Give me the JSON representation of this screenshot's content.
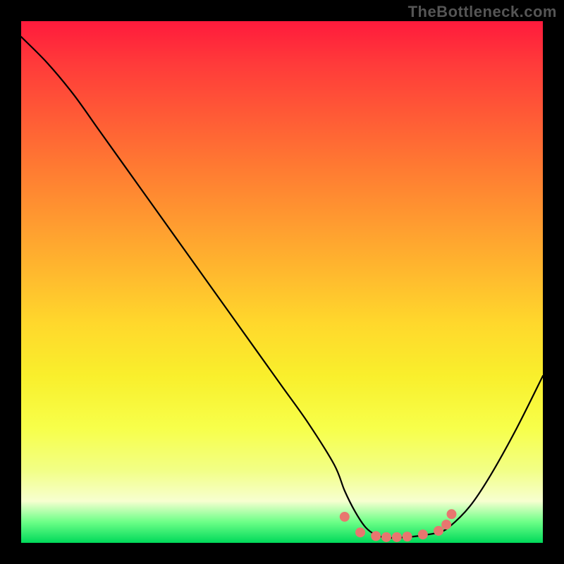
{
  "watermark": "TheBottleneck.com",
  "chart_data": {
    "type": "line",
    "title": "",
    "xlabel": "",
    "ylabel": "",
    "xlim": [
      0,
      100
    ],
    "ylim": [
      0,
      100
    ],
    "categories": [
      0,
      5,
      10,
      15,
      20,
      25,
      30,
      35,
      40,
      45,
      50,
      55,
      60,
      62,
      64,
      66,
      68,
      70,
      72,
      74,
      76,
      78,
      80,
      82,
      86,
      90,
      95,
      100
    ],
    "series": [
      {
        "name": "bottleneck-curve",
        "values": [
          97,
          92,
          86,
          79,
          72,
          65,
          58,
          51,
          44,
          37,
          30,
          23,
          15,
          10,
          6,
          3,
          1.5,
          1,
          1,
          1.1,
          1.3,
          1.6,
          2,
          3,
          7,
          13,
          22,
          32
        ]
      }
    ],
    "markers": {
      "name": "highlight-dots",
      "color": "#e8766f",
      "points": [
        {
          "x": 62,
          "y": 5
        },
        {
          "x": 65,
          "y": 2
        },
        {
          "x": 68,
          "y": 1.3
        },
        {
          "x": 70,
          "y": 1.1
        },
        {
          "x": 72,
          "y": 1.1
        },
        {
          "x": 74,
          "y": 1.2
        },
        {
          "x": 77,
          "y": 1.6
        },
        {
          "x": 80,
          "y": 2.3
        },
        {
          "x": 81.5,
          "y": 3.5
        },
        {
          "x": 82.5,
          "y": 5.5
        }
      ]
    },
    "background_gradient": {
      "top": "#ff1a3c",
      "mid1": "#ff9930",
      "mid2": "#f7ff4a",
      "bottom": "#00d95a"
    },
    "grid": false,
    "legend": false
  }
}
